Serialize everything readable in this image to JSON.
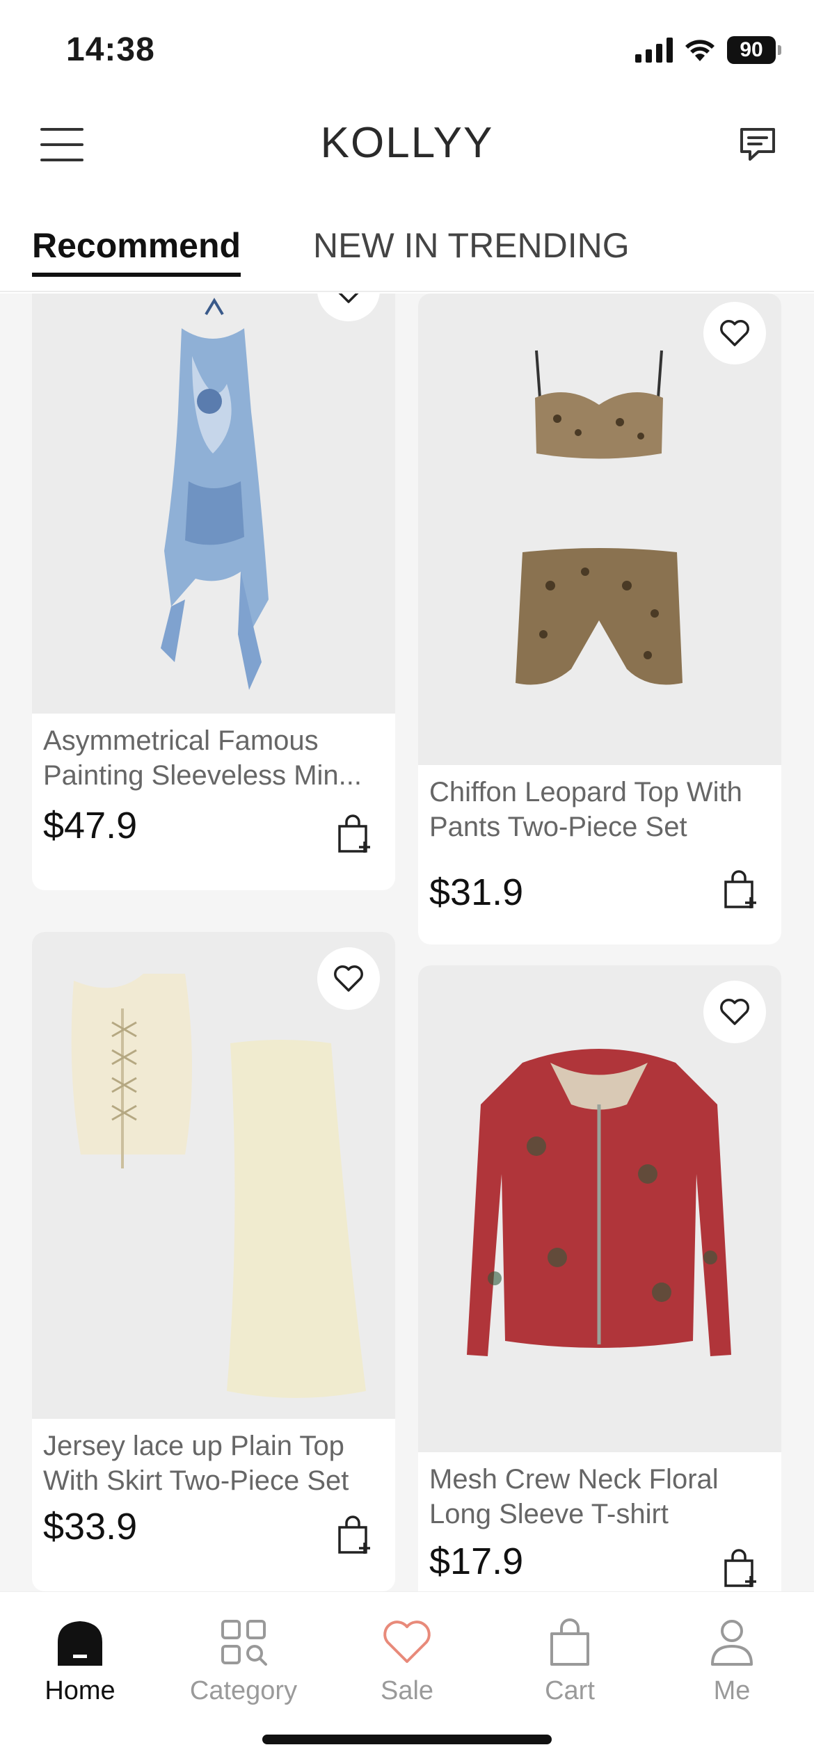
{
  "status": {
    "time": "14:38",
    "battery": "90"
  },
  "header": {
    "brand": "KOLLYY",
    "menu_icon": "hamburger-menu-icon",
    "message_icon": "chat-message-icon"
  },
  "tabs": [
    {
      "label": "Recommend",
      "active": true
    },
    {
      "label": "NEW IN TRENDING",
      "active": false
    }
  ],
  "products": [
    {
      "title_line1": "Asymmetrical Famous",
      "title_line2": "Painting Sleeveless Min...",
      "price": "$47.9",
      "image": "blue-ruffle-dress"
    },
    {
      "title_line1": "Chiffon Leopard Top With",
      "title_line2": "Pants Two-Piece Set",
      "price": "$31.9",
      "image": "leopard-two-piece"
    },
    {
      "title_line1": "Jersey lace up Plain Top",
      "title_line2": "With Skirt Two-Piece Set",
      "price": "$33.9",
      "image": "cream-lace-up-set"
    },
    {
      "title_line1": "Mesh Crew Neck Floral",
      "title_line2": "Long Sleeve T-shirt",
      "price": "$17.9",
      "image": "red-rose-mesh-top"
    }
  ],
  "bottom_nav": [
    {
      "label": "Home",
      "icon": "home-icon",
      "active": true
    },
    {
      "label": "Category",
      "icon": "category-icon",
      "active": false
    },
    {
      "label": "Sale",
      "icon": "heart-sale-icon",
      "active": false
    },
    {
      "label": "Cart",
      "icon": "cart-bag-icon",
      "active": false
    },
    {
      "label": "Me",
      "icon": "profile-icon",
      "active": false
    }
  ],
  "colors": {
    "accent": "#111111",
    "sale_heart": "#e88a7a",
    "inactive": "#9a9a9a",
    "feed_bg": "#f5f5f5"
  }
}
